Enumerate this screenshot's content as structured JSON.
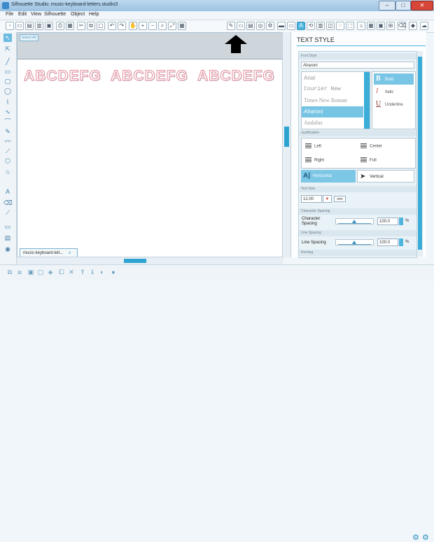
{
  "window": {
    "title": "Silhouette Studio: music-keyboard-letters.studio3",
    "controls": [
      "–",
      "□",
      "✕"
    ]
  },
  "menu": [
    "File",
    "Edit",
    "View",
    "Silhouette",
    "Object",
    "Help"
  ],
  "canvas": {
    "badge": "Select All",
    "letters": [
      "ABCDEFG",
      "ABCDEFG",
      "ABCDEFG"
    ],
    "doc_tab": "music-keyboard-lett...",
    "doc_tab_close": "x"
  },
  "panel": {
    "title": "TEXT STYLE",
    "font_style_header": "Font Style",
    "font_search_value": "Aharoni",
    "fonts": [
      "Arial",
      "Courier New",
      "Times New Roman",
      "Aharoni",
      "Andalus"
    ],
    "selected_font": "Aharoni",
    "styles": [
      {
        "glyph": "B",
        "label": "Bold",
        "selected": true
      },
      {
        "glyph": "I",
        "label": "Italic",
        "selected": false
      },
      {
        "glyph": "U",
        "label": "Underline",
        "selected": false
      }
    ],
    "justification_header": "Justification",
    "justification": {
      "left": "Left",
      "center": "Center",
      "right": "Right",
      "full": "Full"
    },
    "orientation": {
      "horizontal": "Horizontal",
      "vertical": "Vertical",
      "selected": "Horizontal"
    },
    "text_size_header": "Text Size",
    "text_size_value": "12.00",
    "text_size_unit": "mm",
    "char_spacing_header": "Character Spacing",
    "char_spacing_label": "Character Spacing",
    "char_spacing_value": "100.0",
    "line_spacing_header": "Line Spacing",
    "line_spacing_label": "Line Spacing",
    "line_spacing_value": "100.0",
    "percent": "%",
    "kerning_header": "Kerning"
  },
  "colors": {
    "accent": "#2da3d1",
    "letter_outline": "#e38c9b",
    "canvas_band": "#cfd6db"
  }
}
